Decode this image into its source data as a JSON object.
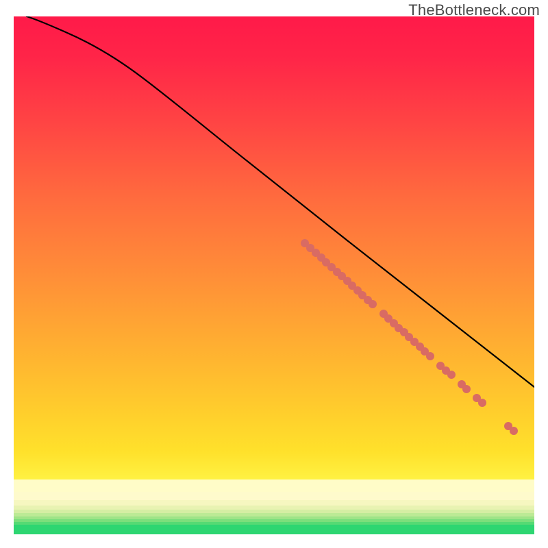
{
  "watermark": "TheBottleneck.com",
  "chart_data": {
    "type": "line",
    "title": "",
    "xlabel": "",
    "ylabel": "",
    "xlim": [
      0,
      100
    ],
    "ylim": [
      0,
      100
    ],
    "grid": false,
    "series": [
      {
        "name": "curve",
        "color": "#000000",
        "x": [
          2.5,
          5,
          10,
          15,
          20,
          25,
          30,
          35,
          40,
          45,
          50,
          55,
          60,
          65,
          70,
          75,
          80,
          85,
          90,
          95,
          100
        ],
        "y": [
          100,
          99.2,
          97.0,
          93.8,
          90.0,
          85.8,
          81.3,
          76.6,
          71.8,
          67.0,
          62.1,
          57.2,
          52.3,
          47.4,
          42.5,
          37.6,
          32.7,
          27.8,
          22.9,
          18.0,
          13.1
        ]
      }
    ],
    "highlighted_points": {
      "name": "marked-segment",
      "color": "#d96b63",
      "points": [
        {
          "x": 56,
          "y": 56.2
        },
        {
          "x": 57,
          "y": 55.2
        },
        {
          "x": 58,
          "y": 54.3
        },
        {
          "x": 59,
          "y": 53.3
        },
        {
          "x": 60,
          "y": 52.3
        },
        {
          "x": 61,
          "y": 51.3
        },
        {
          "x": 62,
          "y": 50.3
        },
        {
          "x": 63,
          "y": 49.4
        },
        {
          "x": 64,
          "y": 48.4
        },
        {
          "x": 65,
          "y": 47.4
        },
        {
          "x": 66,
          "y": 46.4
        },
        {
          "x": 67,
          "y": 45.4
        },
        {
          "x": 68,
          "y": 44.5
        },
        {
          "x": 69,
          "y": 43.5
        },
        {
          "x": 71,
          "y": 41.5
        },
        {
          "x": 72,
          "y": 40.5
        },
        {
          "x": 73,
          "y": 39.6
        },
        {
          "x": 74,
          "y": 38.6
        },
        {
          "x": 75,
          "y": 37.6
        },
        {
          "x": 76,
          "y": 36.6
        },
        {
          "x": 77,
          "y": 35.6
        },
        {
          "x": 78,
          "y": 34.7
        },
        {
          "x": 79,
          "y": 33.7
        },
        {
          "x": 80,
          "y": 32.7
        },
        {
          "x": 82,
          "y": 30.7
        },
        {
          "x": 83,
          "y": 29.7
        },
        {
          "x": 84,
          "y": 28.8
        },
        {
          "x": 86,
          "y": 26.8
        },
        {
          "x": 87,
          "y": 25.8
        },
        {
          "x": 89,
          "y": 23.9
        },
        {
          "x": 90,
          "y": 22.9
        },
        {
          "x": 95,
          "y": 18.0
        },
        {
          "x": 96,
          "y": 17.0
        }
      ]
    },
    "gradient_bands": [
      {
        "y0": 0,
        "y1": 2,
        "color": "#2fd873"
      },
      {
        "y0": 2,
        "y1": 2.8,
        "color": "#58de7a"
      },
      {
        "y0": 2.8,
        "y1": 3.5,
        "color": "#7ce384"
      },
      {
        "y0": 3.5,
        "y1": 4.2,
        "color": "#9ce88f"
      },
      {
        "y0": 4.2,
        "y1": 5,
        "color": "#b8ec99"
      },
      {
        "y0": 5,
        "y1": 6,
        "color": "#d1f1a5"
      },
      {
        "y0": 6,
        "y1": 7,
        "color": "#e4f4b0"
      },
      {
        "y0": 7,
        "y1": 8,
        "color": "#f1f7ba"
      },
      {
        "y0": 8,
        "y1": 10,
        "color": "#f9f9c4"
      },
      {
        "y0": 10,
        "y1": 12,
        "color": "#fefbc8"
      },
      {
        "y0": 12,
        "y1": 15,
        "color": "#fffac0"
      }
    ]
  }
}
